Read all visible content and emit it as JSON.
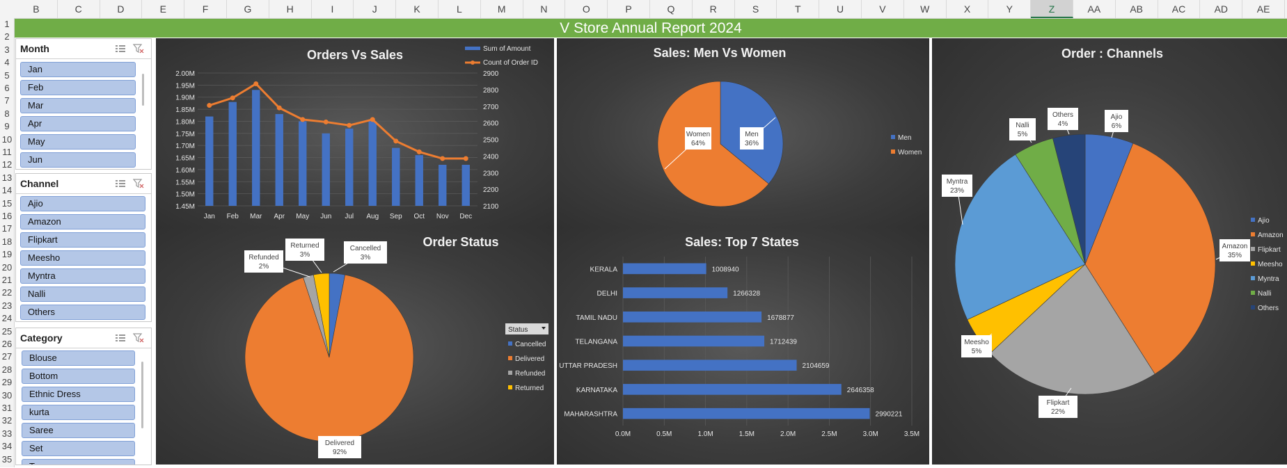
{
  "sheet": {
    "columns": [
      "B",
      "C",
      "D",
      "E",
      "F",
      "G",
      "H",
      "I",
      "J",
      "K",
      "L",
      "M",
      "N",
      "O",
      "P",
      "Q",
      "R",
      "S",
      "T",
      "U",
      "V",
      "W",
      "X",
      "Y",
      "Z",
      "AA",
      "AB",
      "AC",
      "AD",
      "AE"
    ],
    "selected_column": "Z",
    "rows": [
      "1",
      "2",
      "3",
      "4",
      "5",
      "6",
      "7",
      "8",
      "9",
      "10",
      "11",
      "12",
      "13",
      "14",
      "15",
      "16",
      "17",
      "18",
      "19",
      "20",
      "21",
      "22",
      "23",
      "24",
      "25",
      "26",
      "27",
      "28",
      "29",
      "30",
      "31",
      "32",
      "33",
      "34",
      "35"
    ]
  },
  "report_title": "V Store Annual Report 2024",
  "slicers": {
    "month": {
      "label": "Month",
      "items": [
        "Jan",
        "Feb",
        "Mar",
        "Apr",
        "May",
        "Jun"
      ]
    },
    "channel": {
      "label": "Channel",
      "items": [
        "Ajio",
        "Amazon",
        "Flipkart",
        "Meesho",
        "Myntra",
        "Nalli",
        "Others"
      ]
    },
    "category": {
      "label": "Category",
      "items": [
        "Blouse",
        "Bottom",
        "Ethnic Dress",
        "kurta",
        "Saree",
        "Set",
        "Top"
      ]
    }
  },
  "chart_data": [
    {
      "id": "orders_vs_sales",
      "type": "bar",
      "title": "Orders Vs Sales",
      "categories": [
        "Jan",
        "Feb",
        "Mar",
        "Apr",
        "May",
        "Jun",
        "Jul",
        "Aug",
        "Sep",
        "Oct",
        "Nov",
        "Dec"
      ],
      "series": [
        {
          "name": "Sum of Amount",
          "type": "bar",
          "axis": "left",
          "values": [
            1.82,
            1.88,
            1.93,
            1.83,
            1.8,
            1.75,
            1.77,
            1.8,
            1.69,
            1.66,
            1.62,
            1.62
          ]
        },
        {
          "name": "Count of Order ID",
          "type": "line",
          "axis": "right",
          "values": [
            2705,
            2750,
            2835,
            2690,
            2620,
            2605,
            2585,
            2620,
            2490,
            2425,
            2385,
            2385
          ]
        }
      ],
      "ylim_left": [
        1.45,
        2.0
      ],
      "ytick_left": [
        "1.45M",
        "1.50M",
        "1.55M",
        "1.60M",
        "1.65M",
        "1.70M",
        "1.75M",
        "1.80M",
        "1.85M",
        "1.90M",
        "1.95M",
        "2.00M"
      ],
      "ylim_right": [
        2100,
        2900
      ],
      "ytick_right": [
        "2100",
        "2200",
        "2300",
        "2400",
        "2500",
        "2600",
        "2700",
        "2800",
        "2900"
      ],
      "colors": [
        "#4472c4",
        "#ed7d31"
      ],
      "legend": "top-right"
    },
    {
      "id": "men_vs_women",
      "type": "pie",
      "title": "Sales: Men Vs Women",
      "labels": [
        "Men",
        "Women"
      ],
      "values": [
        36,
        64
      ],
      "display": [
        "36%",
        "64%"
      ],
      "colors": [
        "#4472c4",
        "#ed7d31"
      ],
      "legend": "right"
    },
    {
      "id": "order_channels",
      "type": "pie",
      "title": "Order : Channels",
      "labels": [
        "Ajio",
        "Amazon",
        "Flipkart",
        "Meesho",
        "Myntra",
        "Nalli",
        "Others"
      ],
      "values": [
        6,
        35,
        22,
        5,
        23,
        5,
        4
      ],
      "display": [
        "6%",
        "35%",
        "22%",
        "5%",
        "23%",
        "5%",
        "4%"
      ],
      "colors": [
        "#4472c4",
        "#ed7d31",
        "#a5a5a5",
        "#ffc000",
        "#5b9bd5",
        "#70ad47",
        "#264478"
      ],
      "legend": "right"
    },
    {
      "id": "order_status",
      "type": "pie",
      "title": "Order Status",
      "labels": [
        "Cancelled",
        "Delivered",
        "Refunded",
        "Returned"
      ],
      "values": [
        3,
        92,
        2,
        3
      ],
      "display": [
        "3%",
        "92%",
        "2%",
        "3%"
      ],
      "colors": [
        "#4472c4",
        "#ed7d31",
        "#a5a5a5",
        "#ffc000"
      ],
      "legend_title": "Status",
      "legend": "right"
    },
    {
      "id": "top_states",
      "type": "bar",
      "orientation": "horizontal",
      "title": "Sales: Top 7  States",
      "categories": [
        "KERALA",
        "DELHI",
        "TAMIL NADU",
        "TELANGANA",
        "UTTAR PRADESH",
        "KARNATAKA",
        "MAHARASHTRA"
      ],
      "values": [
        1008940,
        1266328,
        1678877,
        1712439,
        2104659,
        2646358,
        2990221
      ],
      "xlim": [
        0,
        3500000
      ],
      "xtick": [
        "0.0M",
        "0.5M",
        "1.0M",
        "1.5M",
        "2.0M",
        "2.5M",
        "3.0M",
        "3.5M"
      ],
      "color": "#4472c4"
    }
  ],
  "colors": {
    "accent_green": "#70ad47",
    "panel_dark": "#3c3c3c",
    "slicer_item": "#b4c7e7"
  }
}
